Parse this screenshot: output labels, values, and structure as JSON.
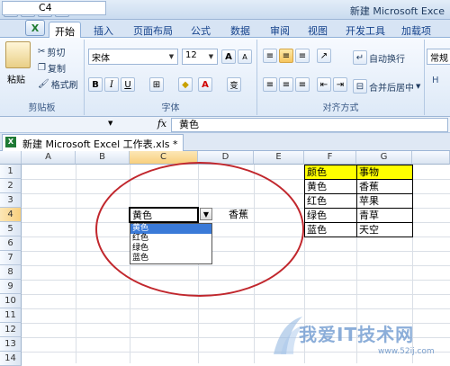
{
  "window": {
    "title": "新建 Microsoft Exce"
  },
  "qat": {
    "save_icon": "save-icon",
    "undo_icon": "undo-icon",
    "redo_icon": "redo-icon",
    "print_icon": "print-preview-icon"
  },
  "tabs": [
    "开始",
    "插入",
    "页面布局",
    "公式",
    "数据",
    "审阅",
    "视图",
    "开发工具",
    "加载项"
  ],
  "office_button": "X",
  "ribbon": {
    "clipboard": {
      "paste": "粘贴",
      "cut": "剪切",
      "copy": "复制",
      "format_painter": "格式刷",
      "group": "剪贴板"
    },
    "font": {
      "name": "宋体",
      "size": "12",
      "grow": "A",
      "shrink": "A",
      "bold": "B",
      "italic": "I",
      "underline": "U",
      "font_color": "A",
      "phonetic": "变",
      "group": "字体"
    },
    "alignment": {
      "wrap_text": "自动换行",
      "merge_center": "合并后居中",
      "group": "对齐方式"
    },
    "number": {
      "format": "常规",
      "collapsed_label": "H"
    }
  },
  "formula_bar": {
    "name_box": "C4",
    "fx": "fx",
    "content": "黄色"
  },
  "doc_tab": {
    "title": "新建 Microsoft Excel 工作表.xls *",
    "icon": "X"
  },
  "sheet": {
    "columns": [
      "A",
      "B",
      "C",
      "D",
      "E",
      "F",
      "G"
    ],
    "rows": [
      "1",
      "2",
      "3",
      "4",
      "5",
      "6",
      "7",
      "8",
      "9",
      "10",
      "11",
      "12",
      "13",
      "14"
    ],
    "table": {
      "header": [
        "颜色",
        "事物"
      ],
      "rows": [
        [
          "黄色",
          "香蕉"
        ],
        [
          "红色",
          "苹果"
        ],
        [
          "绿色",
          "青草"
        ],
        [
          "蓝色",
          "天空"
        ]
      ]
    },
    "active_cell_value": "黄色",
    "d4_value": "香蕉",
    "dropdown_options": [
      "黄色",
      "红色",
      "绿色",
      "蓝色"
    ],
    "highlight_color": "#ffff00",
    "annotation_color": "#c1272d"
  },
  "watermark": {
    "text": "我爱IT技术网",
    "url": "www.52ij.com"
  }
}
